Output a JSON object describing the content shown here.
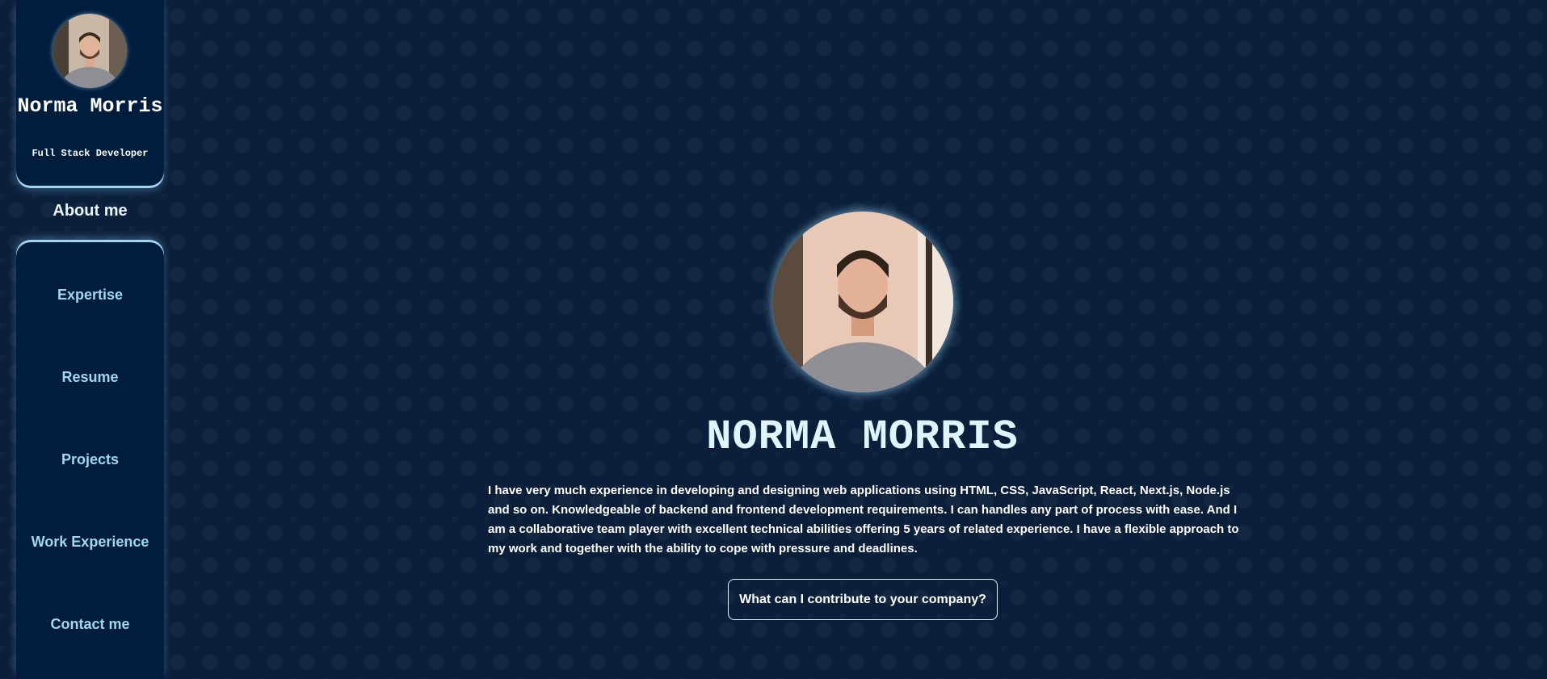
{
  "profile": {
    "name": "Norma Morris",
    "role": "Full Stack Developer",
    "avatar_icon": "person-photo"
  },
  "nav": {
    "active": "About me",
    "items": [
      {
        "label": "Expertise"
      },
      {
        "label": "Resume"
      },
      {
        "label": "Projects"
      },
      {
        "label": "Work Experience"
      },
      {
        "label": "Contact me"
      }
    ]
  },
  "hero": {
    "name": "NORMA MORRIS",
    "bio": "I have very much experience in developing and designing web applications using HTML, CSS, JavaScript, React, Next.js, Node.js and so on. Knowledgeable of backend and frontend development requirements. I can handles any part of process with ease. And I am a collaborative team player with excellent technical abilities offering 5 years of related experience. I have a flexible approach to my work and together with the ability to cope with pressure and deadlines.",
    "cta_label": "What can I contribute to your company?"
  },
  "colors": {
    "background": "#0b1f3a",
    "panel": "#001d3d",
    "accent": "#9fd6f3",
    "title": "#dff4fb"
  }
}
